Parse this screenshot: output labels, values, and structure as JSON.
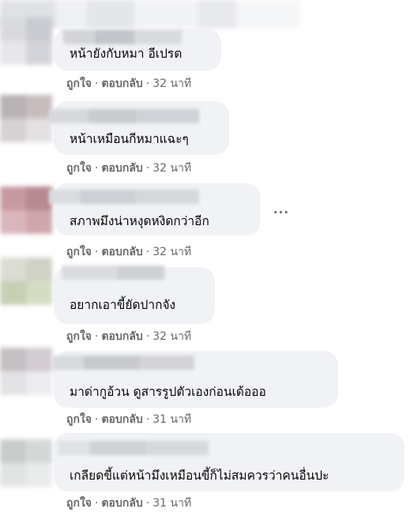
{
  "comments": [
    {
      "text": "หน้ายังกับหมา อีเปรต",
      "actions": {
        "like": "ถูกใจ",
        "reply": "ตอบกลับ",
        "time": "32 นาที"
      }
    },
    {
      "text": "หน้าเหมือนกีหมาแฉะๆ",
      "actions": {
        "like": "ถูกใจ",
        "reply": "ตอบกลับ",
        "time": "32 นาที"
      }
    },
    {
      "text": "สภาพมึงน่าหงุดหงิดกว่าอีก",
      "actions": {
        "like": "ถูกใจ",
        "reply": "ตอบกลับ",
        "time": "32 นาที"
      },
      "more_icon": "more-horizontal-icon"
    },
    {
      "text": "อยากเอาขี้ยัดปากจัง",
      "actions": {
        "like": "ถูกใจ",
        "reply": "ตอบกลับ",
        "time": "32 นาที"
      }
    },
    {
      "text": "มาด่ากูอ้วน ดูสารรูปตัวเองก่อนเด้อออ",
      "actions": {
        "like": "ถูกใจ",
        "reply": "ตอบกลับ",
        "time": "31 นาที"
      }
    },
    {
      "text": "เกลียดขี้แต่หน้ามึงเหมือนขี้ก็ไม่สมควรว่าคนอื่นปะ",
      "actions": {
        "like": "ถูกใจ",
        "reply": "ตอบกลับ",
        "time": "31 นาที"
      }
    }
  ],
  "separator": "·",
  "more_label": "···",
  "colors": {
    "bubble": "#f0f2f5",
    "text": "#050505",
    "secondary": "#65676b"
  }
}
